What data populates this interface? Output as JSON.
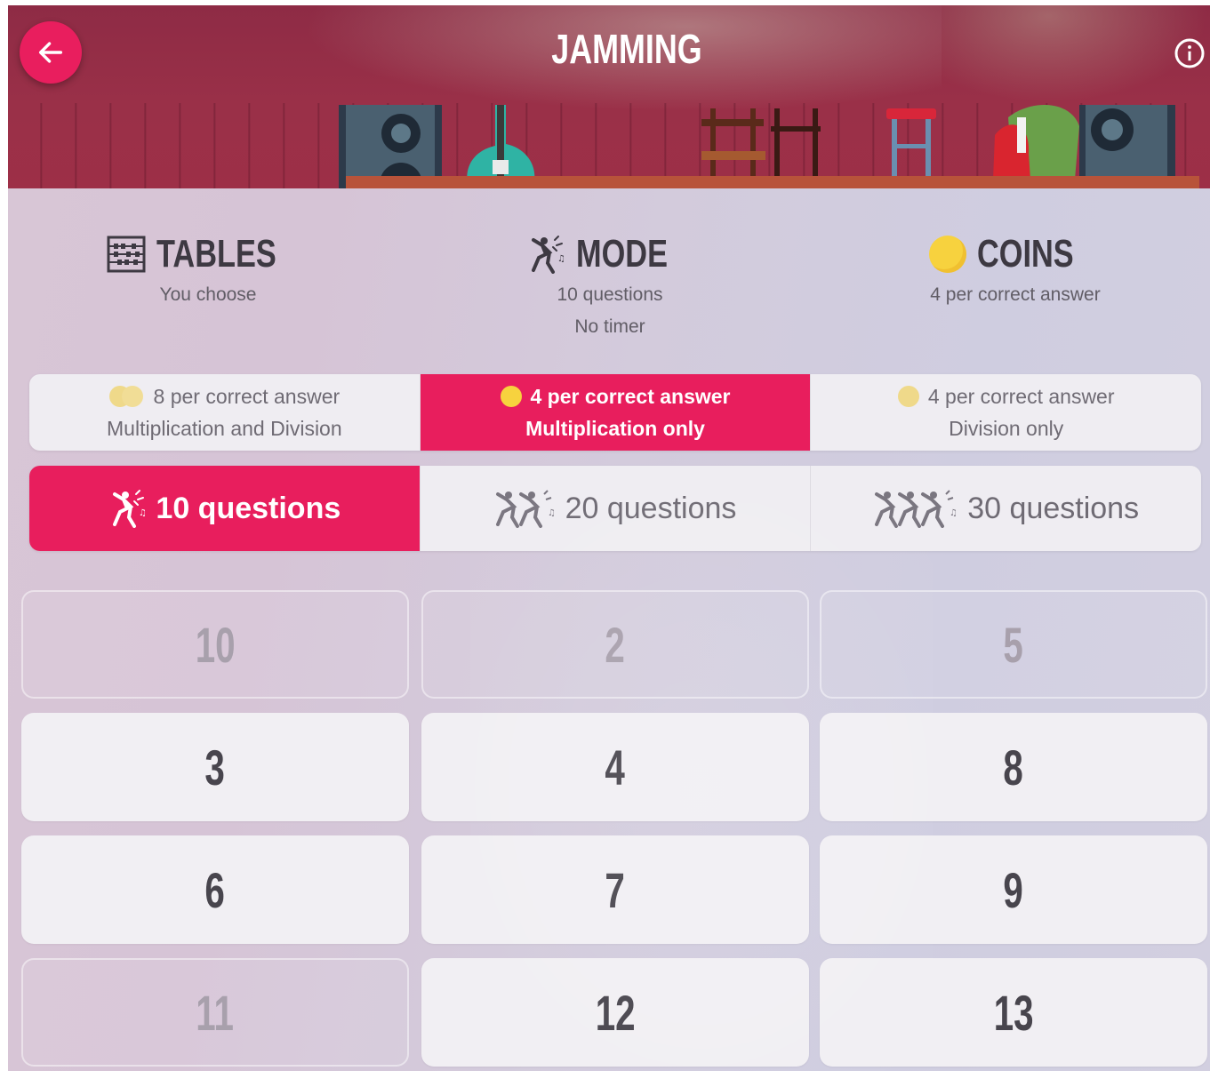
{
  "header": {
    "title": "JAMMING",
    "back_icon": "arrow-left-icon",
    "info_icon": "info-icon",
    "accent_color": "#e91e5e"
  },
  "info": {
    "tables": {
      "title": "TABLES",
      "line1": "You choose",
      "icon": "abacus-icon"
    },
    "mode": {
      "title": "MODE",
      "line1": "10 questions",
      "line2": "No timer",
      "icon": "dancer-icon"
    },
    "coins": {
      "title": "COINS",
      "line1": "4 per correct answer",
      "icon": "coin-icon"
    }
  },
  "operation_options": [
    {
      "line1": "8 per correct answer",
      "line2": "Multiplication and Division",
      "selected": false,
      "icon": "double-coin-icon"
    },
    {
      "line1": "4 per correct answer",
      "line2": "Multiplication only",
      "selected": true,
      "icon": "coin-icon"
    },
    {
      "line1": "4 per correct answer",
      "line2": "Division only",
      "selected": false,
      "icon": "coin-icon"
    }
  ],
  "question_options": [
    {
      "label": "10 questions",
      "selected": true,
      "icon": "dancer-icon"
    },
    {
      "label": "20 questions",
      "selected": false,
      "icon": "two-dancers-icon"
    },
    {
      "label": "30 questions",
      "selected": false,
      "icon": "three-dancers-icon"
    }
  ],
  "tables_grid": [
    {
      "label": "10",
      "enabled": false
    },
    {
      "label": "2",
      "enabled": false
    },
    {
      "label": "5",
      "enabled": false
    },
    {
      "label": "3",
      "enabled": true
    },
    {
      "label": "4",
      "enabled": true
    },
    {
      "label": "8",
      "enabled": true
    },
    {
      "label": "6",
      "enabled": true
    },
    {
      "label": "7",
      "enabled": true
    },
    {
      "label": "9",
      "enabled": true
    },
    {
      "label": "11",
      "enabled": false
    },
    {
      "label": "12",
      "enabled": true
    },
    {
      "label": "13",
      "enabled": true
    }
  ],
  "colors": {
    "selected": "#e81e5d",
    "coin": "#f7d23e"
  }
}
